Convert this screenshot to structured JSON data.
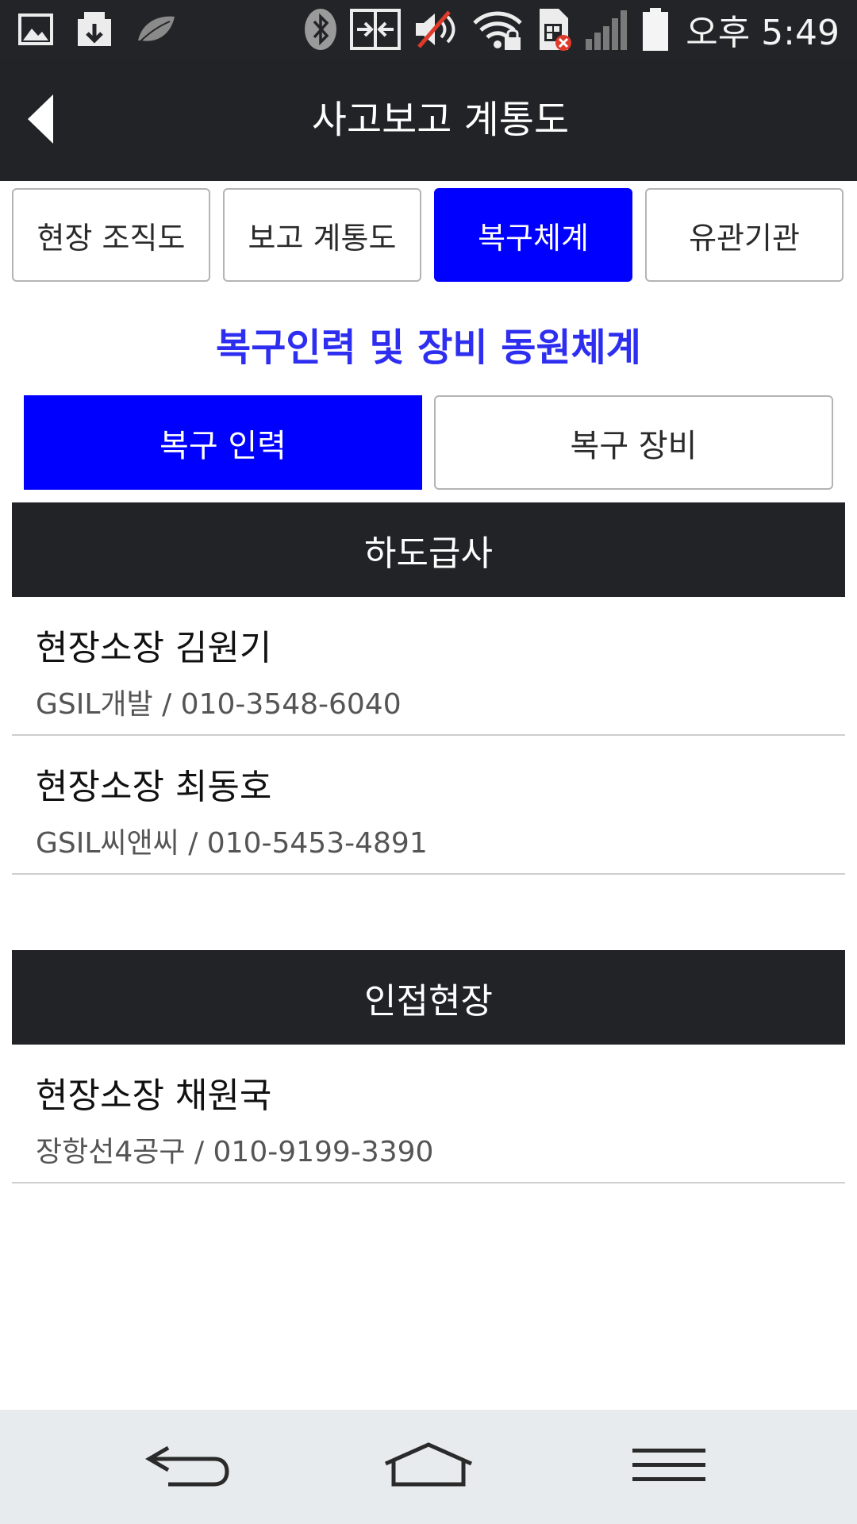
{
  "status_bar": {
    "time": "오후 5:49",
    "icons": [
      "image-icon",
      "download-icon",
      "leaf-icon",
      "bluetooth-icon",
      "nfc-icon",
      "mute-icon",
      "wifi-lock-icon",
      "sim-error-icon",
      "signal-icon",
      "battery-icon"
    ]
  },
  "header": {
    "title": "사고보고 계통도",
    "back_icon": "back-arrow-icon"
  },
  "tabs": [
    {
      "label": "현장 조직도",
      "active": false
    },
    {
      "label": "보고 계통도",
      "active": false
    },
    {
      "label": "복구체계",
      "active": true
    },
    {
      "label": "유관기관",
      "active": false
    }
  ],
  "section_title": "복구인력 및 장비 동원체계",
  "sub_tabs": [
    {
      "label": "복구 인력",
      "active": true
    },
    {
      "label": "복구 장비",
      "active": false
    }
  ],
  "groups": [
    {
      "title": "하도급사",
      "contacts": [
        {
          "name": "현장소장 김원기",
          "detail": "GSIL개발 / 010-3548-6040"
        },
        {
          "name": "현장소장 최동호",
          "detail": "GSIL씨앤씨 / 010-5453-4891"
        }
      ]
    },
    {
      "title": "인접현장",
      "contacts": [
        {
          "name": "현장소장 채원국",
          "detail": "장항선4공구 / 010-9199-3390"
        }
      ]
    }
  ],
  "colors": {
    "accent_blue": "#0000ff",
    "heading_blue": "#2e2ef0",
    "dark_bar": "#212327",
    "nav_bg": "#e7ebee"
  },
  "nav_bar": {
    "icons": [
      "back-icon",
      "home-icon",
      "menu-icon"
    ]
  }
}
